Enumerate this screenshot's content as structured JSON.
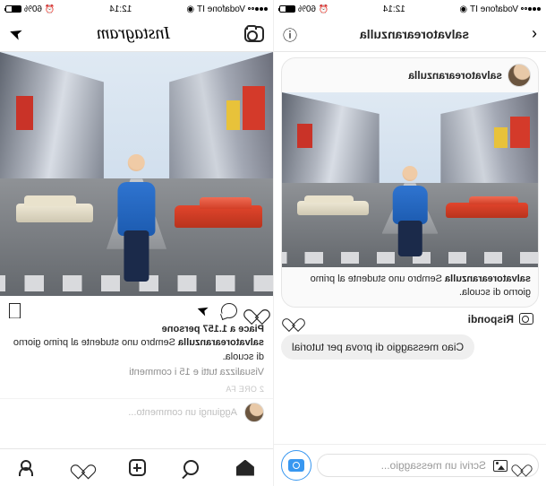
{
  "status": {
    "carrier": "Vodafone IT",
    "battery_pct": "60%",
    "time": "12:14"
  },
  "dm": {
    "header_title": "salvatorearanzulla",
    "card_user": "salvatorearanzulla",
    "caption_user": "salvatorearanzulla",
    "caption_text": "Sembro uno studente al primo giorno di scuola.",
    "reply_label": "Rispondi",
    "outgoing_message": "Ciao messaggio di prova per tutorial",
    "input_placeholder": "Scrivi un messaggio..."
  },
  "feed": {
    "logo_text": "Instagram",
    "likes_text": "Piace a 1.157 persone",
    "caption_user": "salvatorearanzulla",
    "caption_text": "Sembro uno studente al primo giorno di scuola.",
    "view_comments": "Visualizza tutti e 15 i commenti",
    "time_text": "2 ORE FA",
    "add_comment_placeholder": "Aggiungi un commento..."
  }
}
